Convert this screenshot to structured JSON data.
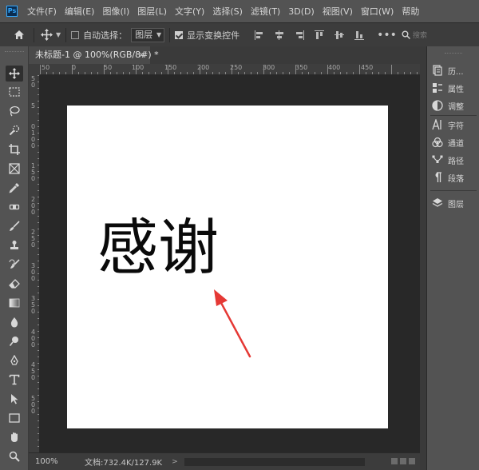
{
  "app": {
    "logo_text": "Ps",
    "menu": [
      "文件(F)",
      "编辑(E)",
      "图像(I)",
      "图层(L)",
      "文字(Y)",
      "选择(S)",
      "滤镜(T)",
      "3D(D)",
      "视图(V)",
      "窗口(W)",
      "帮助"
    ]
  },
  "options": {
    "auto_select_label": "自动选择：",
    "layer_select_value": "图层",
    "show_transform_label": "显示变换控件",
    "search_text": "搜索"
  },
  "document": {
    "tab_title": "未标题-1 @ 100%(RGB/8#) *",
    "canvas_text": "感谢"
  },
  "ruler": {
    "h_labels": [
      "50",
      "0",
      "50",
      "100",
      "150",
      "200",
      "250",
      "300",
      "350",
      "400",
      "450"
    ],
    "v_labels": [
      "5",
      "0",
      "5",
      "0",
      "1",
      "0",
      "0",
      "1",
      "5",
      "0",
      "2",
      "0",
      "0",
      "2",
      "5",
      "0",
      "3",
      "0",
      "0",
      "3",
      "5",
      "0",
      "4",
      "0",
      "0",
      "4",
      "5",
      "0",
      "5",
      "0",
      "0"
    ]
  },
  "status": {
    "zoom": "100%",
    "doc_info": "文档:732.4K/127.9K",
    "arrow": ">"
  },
  "panels": {
    "items": [
      {
        "label": "历...",
        "icon": "history-icon"
      },
      {
        "label": "属性",
        "icon": "properties-icon"
      },
      {
        "label": "调整",
        "icon": "adjustments-icon"
      },
      {
        "label": "字符",
        "icon": "character-icon"
      },
      {
        "label": "通道",
        "icon": "channels-icon"
      },
      {
        "label": "路径",
        "icon": "paths-icon"
      },
      {
        "label": "段落",
        "icon": "paragraph-icon"
      },
      {
        "label": "图层",
        "icon": "layers-icon"
      }
    ]
  },
  "colors": {
    "accent_arrow": "#e53935",
    "canvas_bg": "#282828",
    "ui_bg": "#535353",
    "document": "#ffffff"
  }
}
